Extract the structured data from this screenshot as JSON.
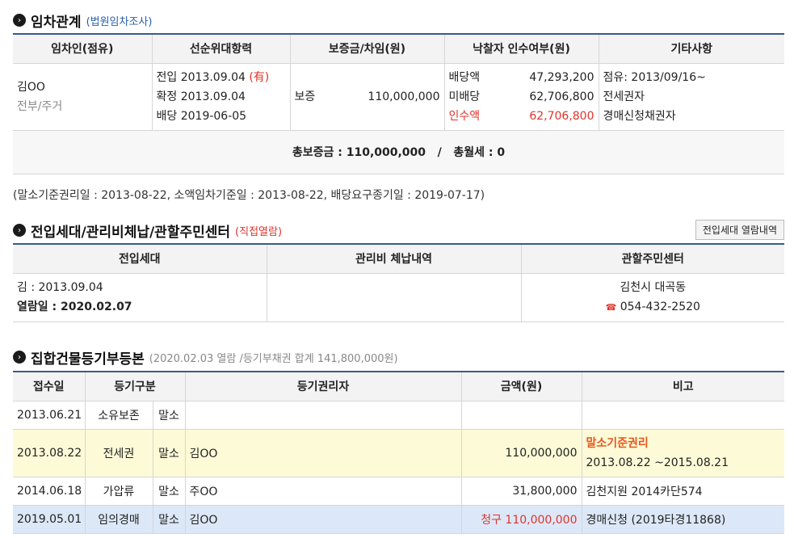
{
  "s1": {
    "title": "임차관계",
    "sub": "(법원임차조사)",
    "headers": [
      "임차인(점유)",
      "선순위대항력",
      "보증금/차임(원)",
      "낙찰자 인수여부(원)",
      "기타사항"
    ],
    "tenant_name": "김OO",
    "tenant_sub": "전부/주거",
    "priority": [
      {
        "label": "전입",
        "date": "2013.09.04",
        "flag": "(有)"
      },
      {
        "label": "확정",
        "date": "2013.09.04"
      },
      {
        "label": "배당",
        "date": "2019-06-05"
      }
    ],
    "deposit_label": "보증",
    "deposit_value": "110,000,000",
    "assume": [
      {
        "label": "배당액",
        "value": "47,293,200"
      },
      {
        "label": "미배당",
        "value": "62,706,800"
      },
      {
        "label": "인수액",
        "value": "62,706,800"
      }
    ],
    "etc": [
      "점유: 2013/09/16~",
      "전세권자",
      "경매신청채권자"
    ],
    "summary": "총보증금 : 110,000,000   /   총월세 : 0",
    "note": "(말소기준권리일 : 2013-08-22, 소액임차기준일 : 2013-08-22, 배당요구종기일 : 2019-07-17)"
  },
  "s2": {
    "title": "전입세대/관리비체납/관할주민센터",
    "sub": "(직접열람)",
    "button": "전입세대 열람내역",
    "headers": [
      "전입세대",
      "관리비 체납내역",
      "관할주민센터"
    ],
    "move_in": "김 : 2013.09.04",
    "view_date": "열람일 : 2020.02.07",
    "center_name": "김천시 대곡동",
    "center_phone": "054-432-2520"
  },
  "s3": {
    "title": "집합건물등기부등본",
    "sub": "(2020.02.03 열람 /등기부채권 합계 141,800,000원)",
    "headers": [
      "접수일",
      "등기구분",
      "등기권리자",
      "금액(원)",
      "비고"
    ],
    "rows": [
      {
        "date": "2013.06.21",
        "type": "소유보존",
        "status": "말소",
        "holder": "",
        "amount": "",
        "note": ""
      },
      {
        "date": "2013.08.22",
        "type": "전세권",
        "status": "말소",
        "holder": "김OO",
        "amount": "110,000,000",
        "note_title": "말소기준권리",
        "note": "2013.08.22 ~2015.08.21"
      },
      {
        "date": "2014.06.18",
        "type": "가압류",
        "status": "말소",
        "holder": "주OO",
        "amount": "31,800,000",
        "note": "김천지원 2014카단574"
      },
      {
        "date": "2019.05.01",
        "type": "임의경매",
        "status": "말소",
        "holder": "김OO",
        "amount_prefix": "청구",
        "amount": "110,000,000",
        "note": "경매신청 (2019타경11868)"
      }
    ]
  }
}
